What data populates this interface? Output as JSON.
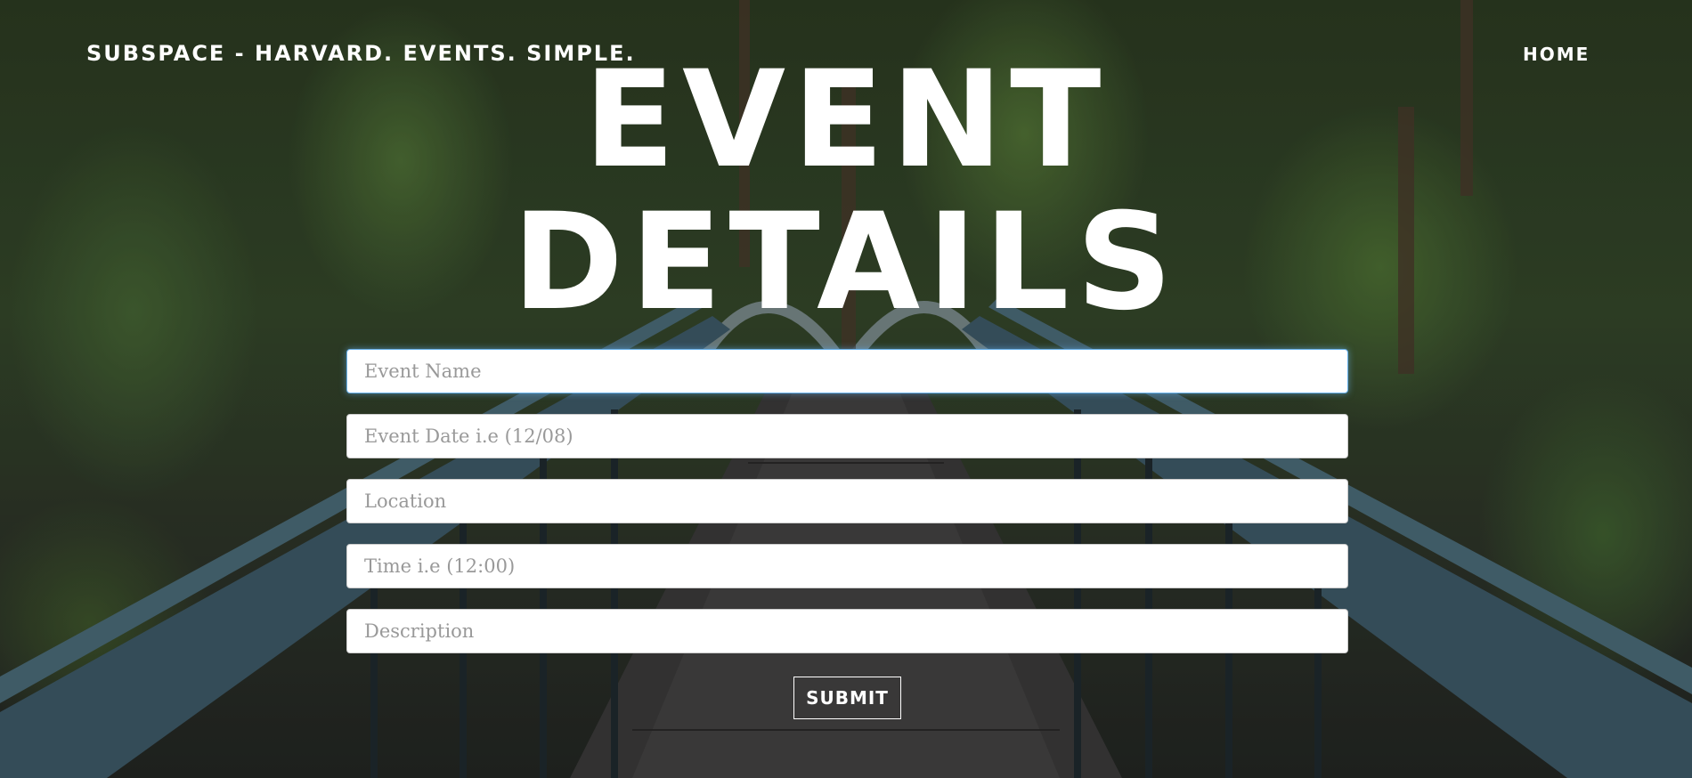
{
  "nav": {
    "brand": "SUBSPACE - HARVARD. EVENTS. SIMPLE.",
    "home_label": "HOME"
  },
  "hero": {
    "title_line1": "EVENT",
    "title_line2": "DETAILS"
  },
  "form": {
    "fields": [
      {
        "placeholder": "Event Name",
        "value": ""
      },
      {
        "placeholder": "Event Date i.e (12/08)",
        "value": ""
      },
      {
        "placeholder": "Location",
        "value": ""
      },
      {
        "placeholder": "Time i.e (12:00)",
        "value": ""
      },
      {
        "placeholder": "Description",
        "value": ""
      }
    ],
    "submit_label": "SUBMIT"
  },
  "colors": {
    "text": "#ffffff",
    "focus_border": "#66afe9",
    "forest_dark": "#2c3b22",
    "bridge_rail": "#3e5a68"
  }
}
